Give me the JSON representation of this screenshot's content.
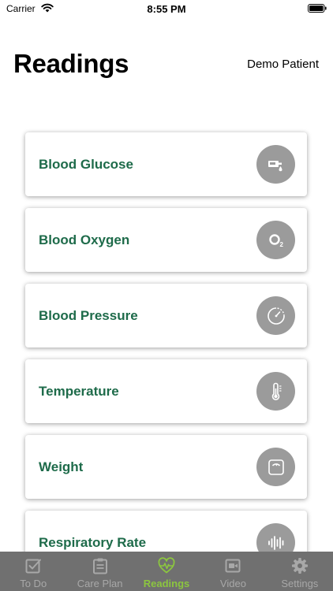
{
  "status_bar": {
    "carrier": "Carrier",
    "time": "8:55 PM"
  },
  "header": {
    "title": "Readings",
    "patient": "Demo Patient"
  },
  "readings": [
    {
      "label": "Blood Glucose",
      "icon": "glucose-meter-icon"
    },
    {
      "label": "Blood Oxygen",
      "icon": "oxygen-o2-icon"
    },
    {
      "label": "Blood Pressure",
      "icon": "pressure-gauge-icon"
    },
    {
      "label": "Temperature",
      "icon": "thermometer-icon"
    },
    {
      "label": "Weight",
      "icon": "scale-icon"
    },
    {
      "label": "Respiratory Rate",
      "icon": "waveform-icon"
    }
  ],
  "tabs": [
    {
      "label": "To Do",
      "icon": "checkbox-icon"
    },
    {
      "label": "Care Plan",
      "icon": "clipboard-icon"
    },
    {
      "label": "Readings",
      "icon": "heart-pulse-icon",
      "active": true
    },
    {
      "label": "Video",
      "icon": "video-camera-icon"
    },
    {
      "label": "Settings",
      "icon": "gear-icon"
    }
  ],
  "colors": {
    "card_label": "#1e6b4a",
    "icon_circle": "#9b9b9b",
    "tab_bar_bg": "#707070",
    "tab_active": "#8cc63f",
    "tab_inactive": "#a8a8a8"
  }
}
